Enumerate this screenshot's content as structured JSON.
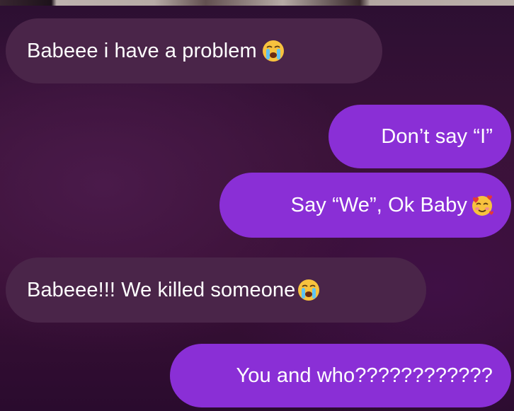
{
  "conversation": {
    "messages": [
      {
        "direction": "incoming",
        "text": "Babeee i have a problem",
        "emoji": "loudly-crying-face-icon"
      },
      {
        "direction": "outgoing",
        "text": "Don’t say “I”",
        "emoji": ""
      },
      {
        "direction": "outgoing",
        "text": "Say “We”, Ok Baby",
        "emoji": "smiling-face-with-hearts-icon"
      },
      {
        "direction": "incoming",
        "text": "Babeee!!! We killed someone",
        "emoji": "loudly-crying-face-icon"
      },
      {
        "direction": "outgoing",
        "text": "You and who????????????",
        "emoji": ""
      }
    ]
  },
  "colors": {
    "incoming_bubble": "#4a2549",
    "outgoing_bubble": "#8a2fd6",
    "background": "#3a1238",
    "text": "#ffffff"
  }
}
